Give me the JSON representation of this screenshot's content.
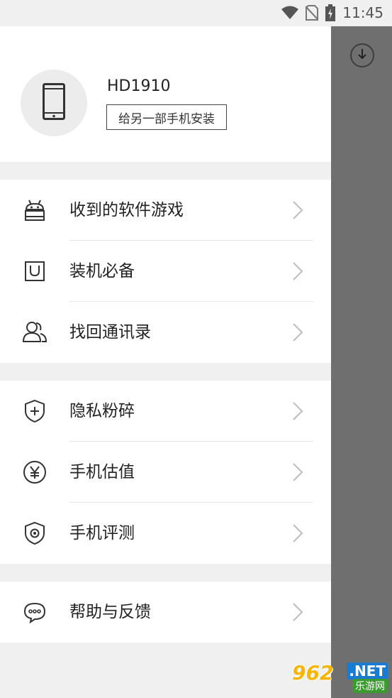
{
  "status_bar": {
    "time": "11:45",
    "icons": [
      "wifi-icon",
      "no-sim-icon",
      "battery-charging-icon"
    ]
  },
  "profile": {
    "device_name": "HD1910",
    "install_button": "给另一部手机安装",
    "avatar_icon": "phone-icon"
  },
  "menu_groups": [
    {
      "items": [
        {
          "label": "收到的软件游戏",
          "icon": "android-icon"
        },
        {
          "label": "装机必备",
          "icon": "shopping-bag-icon"
        },
        {
          "label": "找回通讯录",
          "icon": "contacts-icon"
        }
      ]
    },
    {
      "items": [
        {
          "label": "隐私粉碎",
          "icon": "shield-plus-icon"
        },
        {
          "label": "手机估值",
          "icon": "yen-icon"
        },
        {
          "label": "手机评测",
          "icon": "shield-eye-icon"
        }
      ]
    },
    {
      "items": [
        {
          "label": "帮助与反馈",
          "icon": "chat-bubble-icon"
        }
      ]
    }
  ],
  "scrim": {
    "button_icon": "download-icon"
  },
  "watermark": {
    "number": "962",
    "suffix": ".NET",
    "site": "乐游网"
  },
  "colors": {
    "accent_icon": "#333333",
    "background": "#f0f0f0",
    "scrim": "#6f6f6f"
  }
}
